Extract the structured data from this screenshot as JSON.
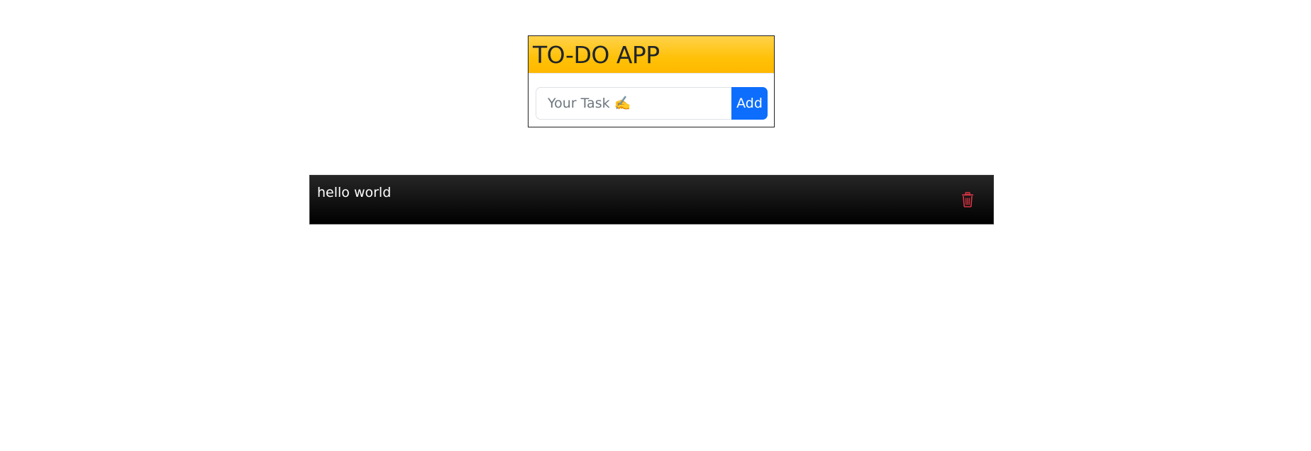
{
  "app": {
    "title": "TO-DO APP"
  },
  "task_form": {
    "placeholder": "Your Task ✍️",
    "add_label": "Add"
  },
  "tasks": [
    {
      "text": "hello world",
      "delete_icon": "trash-icon"
    }
  ],
  "colors": {
    "header_accent": "#ffc107",
    "add_button": "#0d6efd",
    "delete_icon": "#dc3545",
    "task_background": "#000000"
  }
}
